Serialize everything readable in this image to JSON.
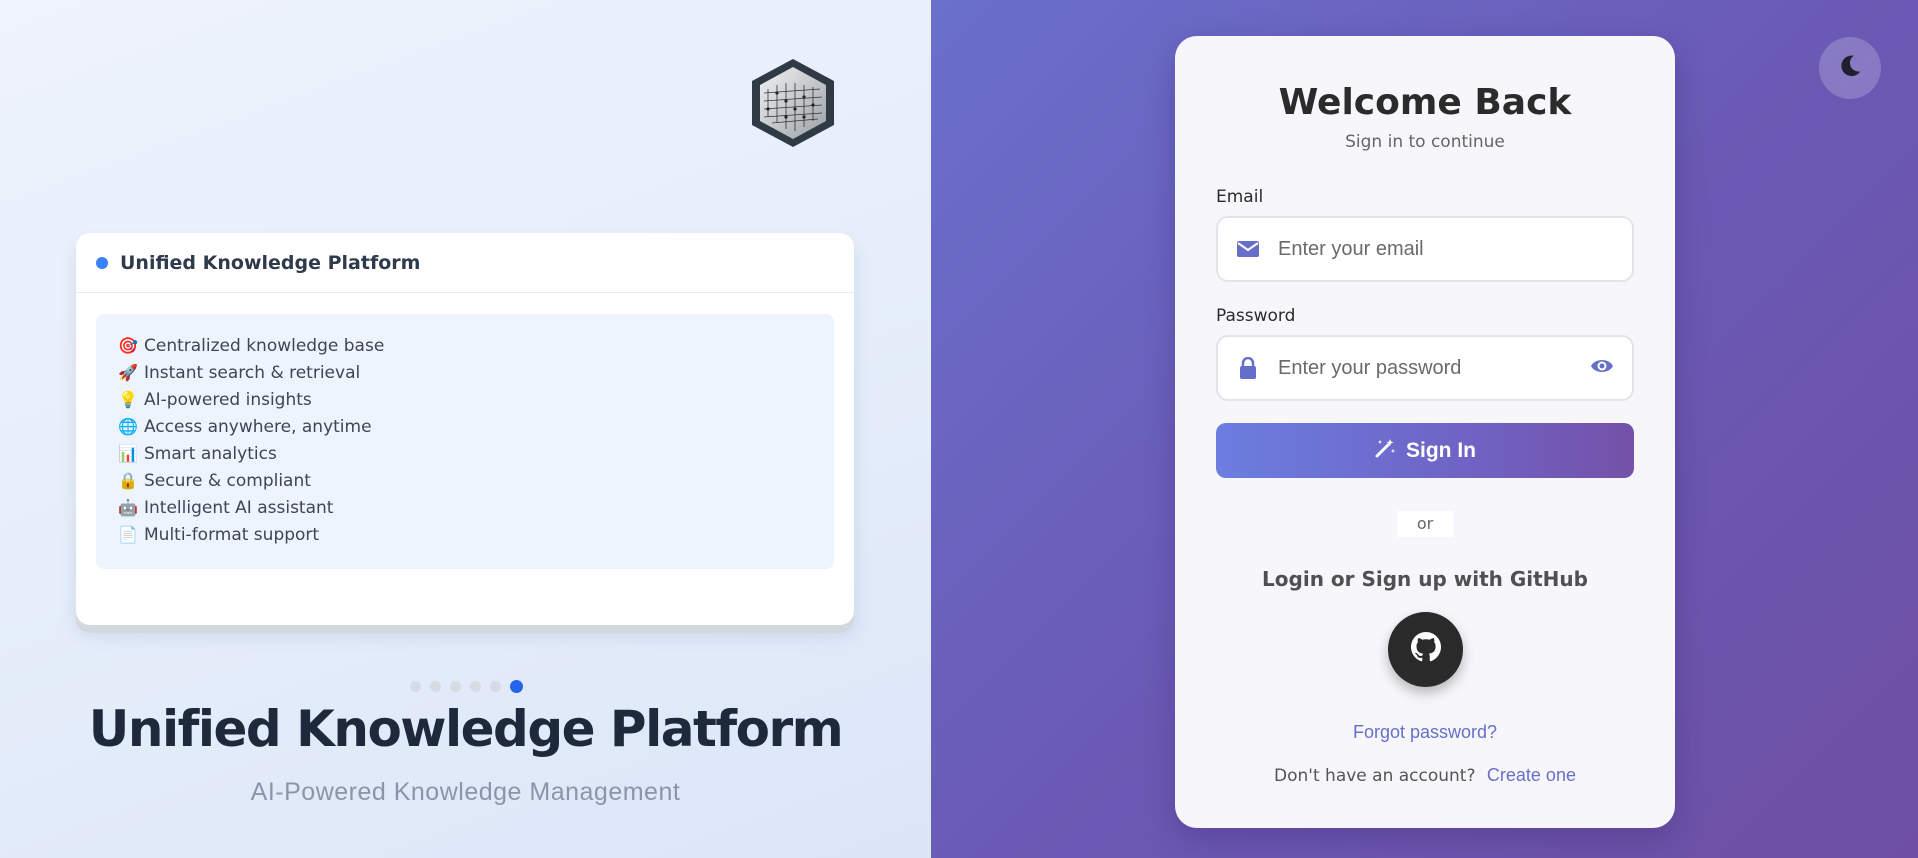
{
  "left": {
    "card": {
      "title": "Unified Knowledge Platform",
      "features": [
        {
          "emoji": "🎯",
          "text": "Centralized knowledge base"
        },
        {
          "emoji": "🚀",
          "text": "Instant search & retrieval"
        },
        {
          "emoji": "💡",
          "text": "AI-powered insights"
        },
        {
          "emoji": "🌐",
          "text": "Access anywhere, anytime"
        },
        {
          "emoji": "📊",
          "text": "Smart analytics"
        },
        {
          "emoji": "🔒",
          "text": "Secure & compliant"
        },
        {
          "emoji": "🤖",
          "text": "Intelligent AI assistant"
        },
        {
          "emoji": "📄",
          "text": "Multi-format support"
        }
      ]
    },
    "carousel": {
      "total": 6,
      "active_index": 5
    },
    "hero_title": "Unified Knowledge Platform",
    "hero_subtitle": "AI-Powered Knowledge Management"
  },
  "login": {
    "title": "Welcome Back",
    "subtitle": "Sign in to continue",
    "email_label": "Email",
    "email_placeholder": "Enter your email",
    "password_label": "Password",
    "password_placeholder": "Enter your password",
    "signin_label": "Sign In",
    "divider": "or",
    "github_text": "Login or Sign up with GitHub",
    "forgot": "Forgot password?",
    "no_account": "Don't have an account?",
    "create": "Create one"
  },
  "icons": {
    "logo": "cube-grid-logo",
    "theme": "moon-icon",
    "email": "envelope-icon",
    "password": "lock-icon",
    "toggle_password": "eye-icon",
    "signin": "magic-wand-icon",
    "github": "github-icon"
  },
  "colors": {
    "accent": "#6770c9",
    "active_dot": "#2563eb",
    "gradient_start": "#6a70cc",
    "gradient_end": "#6e4fa4"
  }
}
